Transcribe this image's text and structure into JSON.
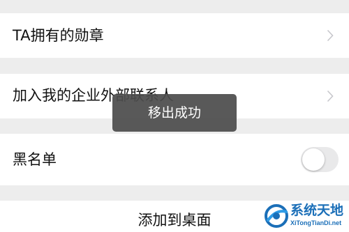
{
  "settings": {
    "badges_label": "TA拥有的勋章",
    "contacts_label": "加入我的企业外部联系人",
    "blacklist_label": "黑名单",
    "blacklist_enabled": false,
    "add_to_desktop_label": "添加到桌面"
  },
  "toast": {
    "message": "移出成功"
  },
  "watermark": {
    "title": "系统天地",
    "url": "XiTongTianDi.net"
  },
  "icons": {
    "chevron": "chevron-right-icon",
    "logo": "xitongtiandi-logo-icon"
  },
  "colors": {
    "background": "#ededed",
    "row": "#ffffff",
    "toast": "#4c4c4c",
    "toggle_off": "#e9e9ea",
    "watermark": "#1b6fb8"
  }
}
